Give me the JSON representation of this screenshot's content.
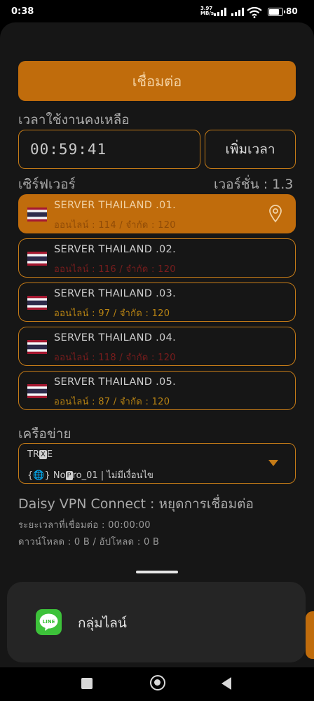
{
  "status_bar": {
    "time": "0:38",
    "net_speed_value": "3.97",
    "net_speed_unit": "MB/s",
    "battery": "80"
  },
  "connect_button": "เชื่อมต่อ",
  "time_remaining_label": "เวลาใช้งานคงเหลือ",
  "time_remaining": "00:59:41",
  "add_time_button": "เพิ่มเวลา",
  "server_label": "เซิร์ฟเวอร์",
  "version_label": "เวอร์ชั่น : 1.3",
  "servers": [
    {
      "name": "SERVER THAILAND .01.",
      "stats": "ออนไลน์ : 114 / จำกัด : 120"
    },
    {
      "name": "SERVER THAILAND .02.",
      "stats": "ออนไลน์ : 116 / จำกัด : 120"
    },
    {
      "name": "SERVER THAILAND .03.",
      "stats": "ออนไลน์ : 97 / จำกัด : 120"
    },
    {
      "name": "SERVER THAILAND .04.",
      "stats": "ออนไลน์ : 118 / จำกัด : 120"
    },
    {
      "name": "SERVER THAILAND .05.",
      "stats": "ออนไลน์ : 87 / จำกัด : 120"
    }
  ],
  "network_label": "เครือข่าย",
  "network": {
    "carrier_prefix": "TR",
    "carrier_box": "X",
    "carrier_suffix": "E",
    "plan_prefix": "{🌐} No",
    "plan_box": "P",
    "plan_suffix": "ro_01 | ไม่มีเงื่อนไข"
  },
  "connection_status": "Daisy VPN Connect : หยุดการเชื่อมต่อ",
  "connected_time": "ระยะเวลาที่เชื่อมต่อ : 00:00:00",
  "traffic": "ดาวน์โหลด : 0 B / อัปโหลด : 0 B",
  "popup": {
    "icon_text": "LINE",
    "label": "กลุ่มไลน์"
  },
  "colors": {
    "accent": "#c06c0c",
    "border": "#c57b17",
    "background": "#161616"
  }
}
